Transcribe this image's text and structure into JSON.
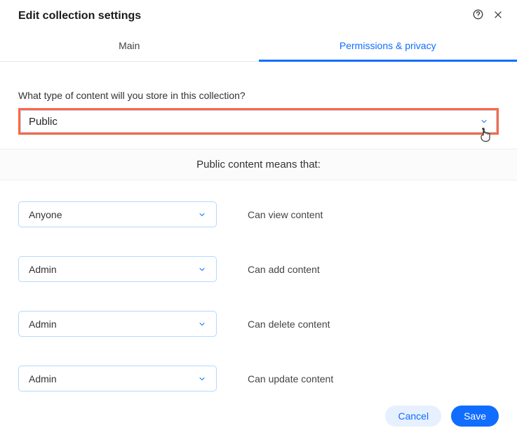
{
  "header": {
    "title": "Edit collection settings"
  },
  "tabs": {
    "main": "Main",
    "permissions": "Permissions & privacy"
  },
  "question": "What type of content will you store in this collection?",
  "content_type_selected": "Public",
  "banner_text": "Public content means that:",
  "permissions": [
    {
      "selected": "Anyone",
      "label": "Can view content"
    },
    {
      "selected": "Admin",
      "label": "Can add content"
    },
    {
      "selected": "Admin",
      "label": "Can delete content"
    },
    {
      "selected": "Admin",
      "label": "Can update content"
    }
  ],
  "footer": {
    "cancel": "Cancel",
    "save": "Save"
  }
}
